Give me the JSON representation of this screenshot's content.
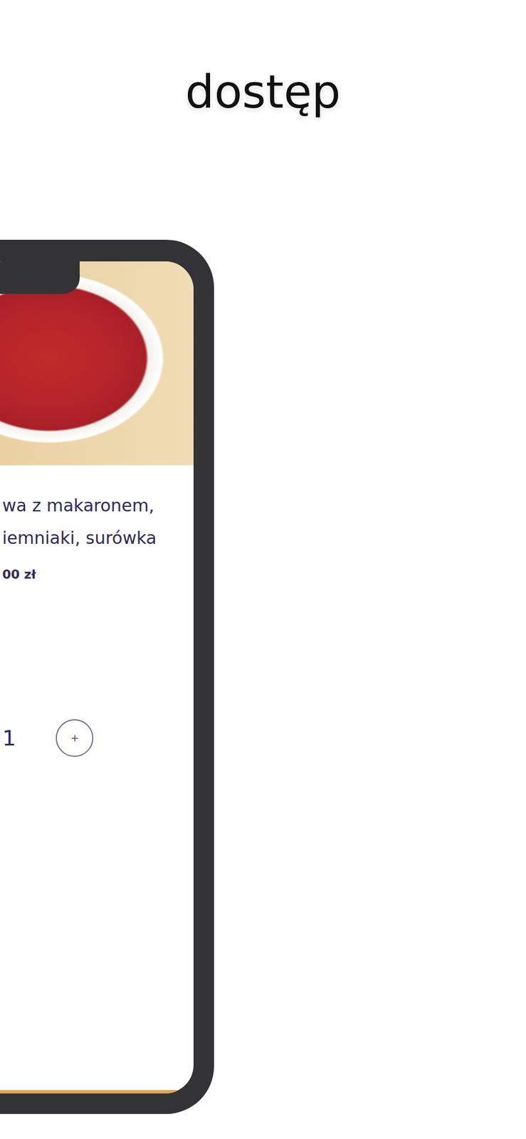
{
  "heading": "dostęp",
  "phone": {
    "product": {
      "name_lines": [
        "wa z makaronem,",
        "iemniaki, surówka"
      ],
      "price": "00 zł",
      "quantity": "1",
      "increment": "+"
    }
  }
}
